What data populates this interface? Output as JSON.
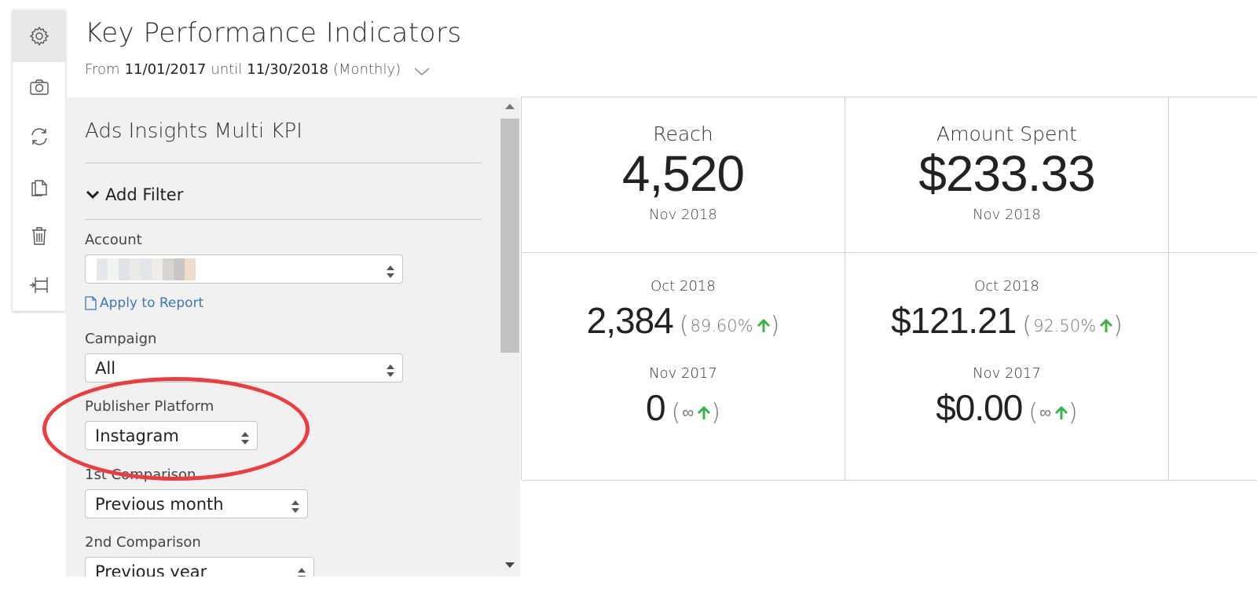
{
  "toolbar": {
    "items": [
      {
        "icon": "gear-icon",
        "active": true
      },
      {
        "icon": "camera-icon"
      },
      {
        "icon": "refresh-icon"
      },
      {
        "icon": "copy-icon"
      },
      {
        "icon": "trash-icon"
      },
      {
        "icon": "resize-icon"
      }
    ]
  },
  "header": {
    "title": "Key Performance Indicators",
    "from_label": "From",
    "start_date": "11/01/2017",
    "until_label": "until",
    "end_date": "11/30/2018",
    "interval": "(Monthly)"
  },
  "panel": {
    "title": "Ads Insights Multi KPI",
    "add_filter": "Add Filter",
    "account_label": "Account",
    "apply_to_report": "Apply to Report",
    "campaign_label": "Campaign",
    "campaign_value": "All",
    "publisher_label": "Publisher Platform",
    "publisher_value": "Instagram",
    "comparison1_label": "1st Comparison",
    "comparison1_value": "Previous month",
    "comparison2_label": "2nd Comparison",
    "comparison2_value": "Previous year"
  },
  "kpis": [
    {
      "name": "Reach",
      "value": "4,520",
      "period": "Nov 2018",
      "comparisons": [
        {
          "period": "Oct 2018",
          "value": "2,384",
          "pct": "89.60%",
          "direction": "up"
        },
        {
          "period": "Nov 2017",
          "value": "0",
          "pct": "∞",
          "direction": "up"
        }
      ]
    },
    {
      "name": "Amount Spent",
      "value": "$233.33",
      "period": "Nov 2018",
      "comparisons": [
        {
          "period": "Oct 2018",
          "value": "$121.21",
          "pct": "92.50%",
          "direction": "up"
        },
        {
          "period": "Nov 2017",
          "value": "$0.00",
          "pct": "∞",
          "direction": "up"
        }
      ]
    }
  ],
  "colors": {
    "accent_link": "#3a78b5",
    "up_green": "#3ab54a",
    "highlight_red": "#ee3b3b",
    "panel_bg": "#f1f1f1"
  }
}
